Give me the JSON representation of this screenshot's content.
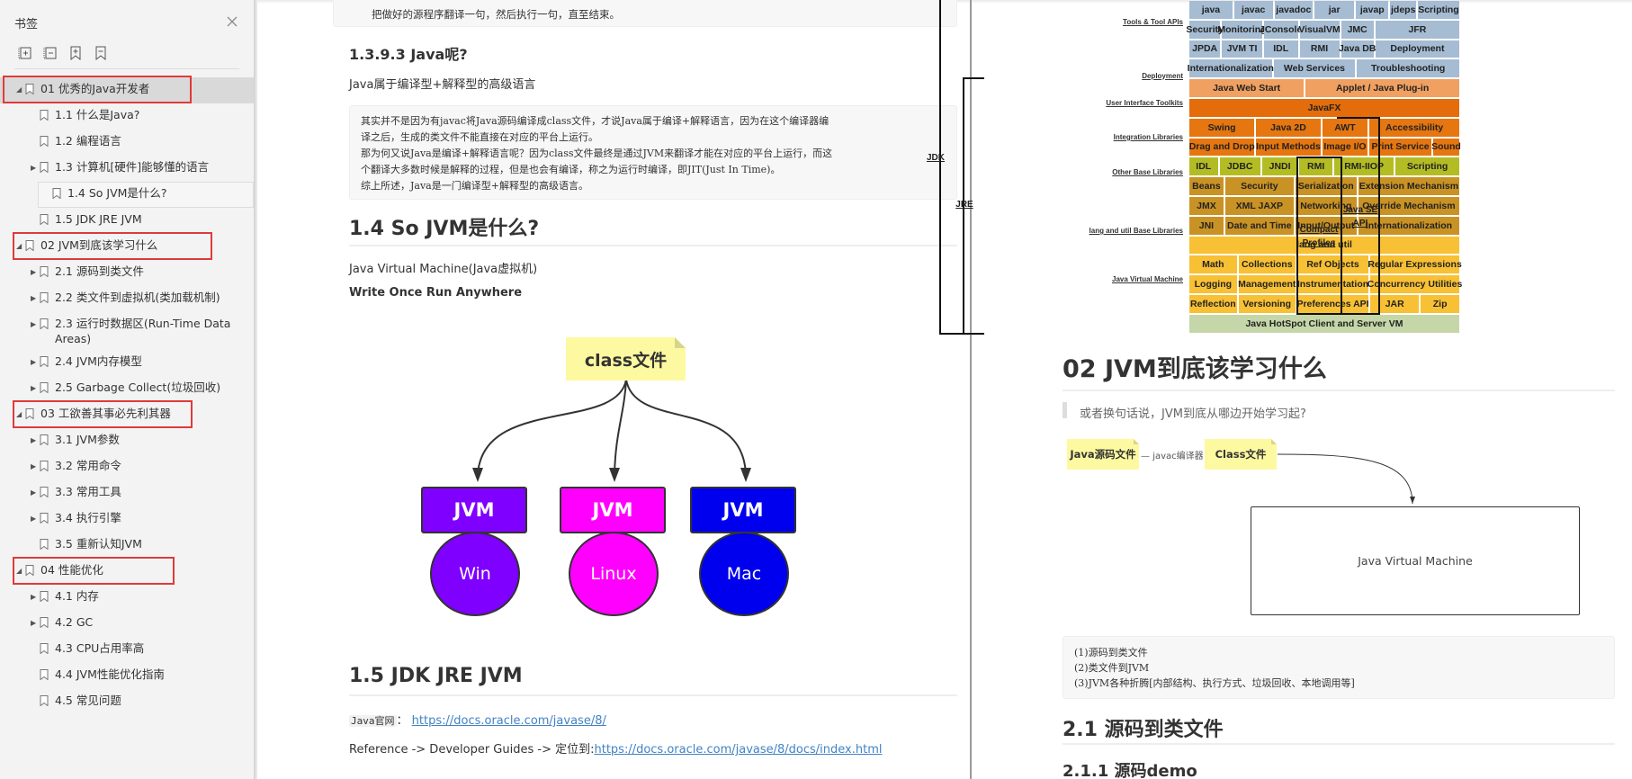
{
  "sidebar": {
    "title": "书签",
    "close_icon": "close-icon",
    "toolbar": [
      {
        "name": "expand-all-icon",
        "title": "expand all"
      },
      {
        "name": "collapse-all-icon",
        "title": "collapse all"
      },
      {
        "name": "add-bookmark-icon",
        "title": "add bookmark"
      },
      {
        "name": "remove-bookmark-icon",
        "title": "remove bookmark"
      }
    ],
    "items": [
      {
        "level": 0,
        "label": "01 优秀的Java开发者",
        "expanded": true,
        "hasChildren": true,
        "highlighted": true,
        "selected": true
      },
      {
        "level": 1,
        "label": "1.1 什么是Java?",
        "hasChildren": false
      },
      {
        "level": 1,
        "label": "1.2 编程语言",
        "hasChildren": false
      },
      {
        "level": 1,
        "label": "1.3 计算机[硬件]能够懂的语言",
        "hasChildren": true
      },
      {
        "level": 1,
        "label": "1.4 So JVM是什么?",
        "hasChildren": false,
        "current": true
      },
      {
        "level": 1,
        "label": "1.5 JDK JRE JVM",
        "hasChildren": false
      },
      {
        "level": 0,
        "label": "02 JVM到底该学习什么",
        "expanded": true,
        "hasChildren": true,
        "highlighted": true
      },
      {
        "level": 1,
        "label": "2.1 源码到类文件",
        "hasChildren": true
      },
      {
        "level": 1,
        "label": "2.2 类文件到虚拟机(类加载机制)",
        "hasChildren": true
      },
      {
        "level": 1,
        "label": "2.3 运行时数据区(Run-Time Data Areas)",
        "hasChildren": true
      },
      {
        "level": 1,
        "label": "2.4 JVM内存模型",
        "hasChildren": true
      },
      {
        "level": 1,
        "label": "2.5 Garbage Collect(垃圾回收)",
        "hasChildren": true
      },
      {
        "level": 0,
        "label": "03 工欲善其事必先利其器",
        "expanded": true,
        "hasChildren": true,
        "highlighted": true
      },
      {
        "level": 1,
        "label": "3.1 JVM参数",
        "hasChildren": true
      },
      {
        "level": 1,
        "label": "3.2 常用命令",
        "hasChildren": true
      },
      {
        "level": 1,
        "label": "3.3 常用工具",
        "hasChildren": true
      },
      {
        "level": 1,
        "label": "3.4 执行引擎",
        "hasChildren": true
      },
      {
        "level": 1,
        "label": "3.5 重新认知JVM",
        "hasChildren": false
      },
      {
        "level": 0,
        "label": "04 性能优化",
        "expanded": true,
        "hasChildren": true,
        "highlighted": true
      },
      {
        "level": 1,
        "label": "4.1 内存",
        "hasChildren": true
      },
      {
        "level": 1,
        "label": "4.2 GC",
        "hasChildren": true
      },
      {
        "level": 1,
        "label": "4.3 CPU占用率高",
        "hasChildren": false
      },
      {
        "level": 1,
        "label": "4.4 JVM性能优化指南",
        "hasChildren": false
      },
      {
        "level": 1,
        "label": "4.5 常见问题",
        "hasChildren": false
      }
    ]
  },
  "page1": {
    "top_code_line": "把做好的源程序翻译一句，然后执行一句，直至结束。",
    "h_1393": "1.3.9.3 Java呢?",
    "p_1393": "Java属于编译型+解释型的高级语言",
    "code_1393": [
      "其实并不是因为有javac将Java源码编译成class文件，才说Java属于编译+解释语言，因为在这个编译器编",
      "译之后，生成的类文件不能直接在对应的平台上运行。",
      "那为何又说Java是编译+解释语言呢？因为class文件最终是通过JVM来翻译才能在对应的平台上运行，而这",
      "个翻译大多数时候是解释的过程，但是也会有编译，称之为运行时编译，即JIT(Just In Time)。",
      "综上所述，Java是一门编译型+解释型的高级语言。"
    ],
    "h_14": "1.4 So JVM是什么?",
    "p_14_a": "Java Virtual Machine(Java虚拟机)",
    "p_14_b": "Write Once Run Anywhere",
    "diagram": {
      "root": "class文件",
      "nodes": [
        {
          "box": "JVM",
          "os": "Win",
          "color": "#7f00ff"
        },
        {
          "box": "JVM",
          "os": "Linux",
          "color": "#ff00ff"
        },
        {
          "box": "JVM",
          "os": "Mac",
          "color": "#0000ee"
        }
      ]
    },
    "h_15": "1.5 JDK JRE JVM",
    "p_15_code": "Java官网",
    "p_15_sep": "：",
    "p_15_link": "https://docs.oracle.com/javase/8/",
    "p_15b_text": "Reference -> Developer Guides -> 定位到:",
    "p_15b_link": "https://docs.oracle.com/javase/8/docs/index.html"
  },
  "jse_diagram": {
    "colors": {
      "tools": "#a5bcd3",
      "deploy": "#f0a060",
      "ui": "#e6760f",
      "integration": "#b4bc24",
      "other": "#c99224",
      "lang": "#f8c034",
      "vm": "#c5d7a8"
    },
    "side_labels": {
      "tools": "Tools & Tool APIs",
      "deploy": "Deployment",
      "ui": "User Interface Toolkits",
      "integration": "Integration Libraries",
      "other": "Other Base Libraries",
      "lang": "lang and util Base Libraries",
      "vm": "Java Virtual Machine"
    },
    "brackets": {
      "jdk": "JDK",
      "jre": "JRE",
      "compact": "Compact Profiles",
      "javase": "Java SE API"
    },
    "rows": [
      {
        "group": "tools",
        "cells": [
          "java",
          "javac",
          "javadoc",
          "jar",
          "javap",
          "jdeps",
          "Scripting"
        ]
      },
      {
        "group": "tools",
        "cells": [
          "Security",
          "Monitoring",
          "JConsole",
          "VisualVM",
          "JMC",
          "JFR"
        ]
      },
      {
        "group": "tools",
        "cells": [
          "JPDA",
          "JVM TI",
          "IDL",
          "RMI",
          "Java DB",
          "Deployment"
        ]
      },
      {
        "group": "tools",
        "cells": [
          "Internationalization",
          "Web Services",
          "Troubleshooting"
        ]
      },
      {
        "group": "deploy",
        "cells": [
          "Java Web Start",
          "Applet / Java Plug-in"
        ]
      },
      {
        "group": "ui",
        "cells": [
          "JavaFX"
        ]
      },
      {
        "group": "ui",
        "cells": [
          "Swing",
          "Java 2D",
          "AWT",
          "Accessibility"
        ]
      },
      {
        "group": "ui",
        "cells": [
          "Drag and Drop",
          "Input Methods",
          "Image I/O",
          "Print Service",
          "Sound"
        ]
      },
      {
        "group": "integration",
        "cells": [
          "IDL",
          "JDBC",
          "JNDI",
          "RMI",
          "RMI-IIOP",
          "Scripting"
        ]
      },
      {
        "group": "other",
        "cells": [
          "Beans",
          "Security",
          "Serialization",
          "Extension Mechanism"
        ]
      },
      {
        "group": "other",
        "cells": [
          "JMX",
          "XML JAXP",
          "Networking",
          "Override Mechanism"
        ]
      },
      {
        "group": "other",
        "cells": [
          "JNI",
          "Date and Time",
          "Input/Output",
          "Internationalization"
        ]
      },
      {
        "group": "lang",
        "cells": [
          "lang and util"
        ]
      },
      {
        "group": "lang",
        "cells": [
          "Math",
          "Collections",
          "Ref Objects",
          "Regular Expressions"
        ]
      },
      {
        "group": "lang",
        "cells": [
          "Logging",
          "Management",
          "Instrumentation",
          "Concurrency Utilities"
        ]
      },
      {
        "group": "lang",
        "cells": [
          "Reflection",
          "Versioning",
          "Preferences API",
          "JAR",
          "Zip"
        ]
      },
      {
        "group": "vm",
        "cells": [
          "Java HotSpot Client and Server VM"
        ]
      }
    ]
  },
  "page2": {
    "h_02": "02 JVM到底该学习什么",
    "quote": "或者换句话说，JVM到底从哪边开始学习起?",
    "flow": {
      "src": "Java源码文件",
      "edge": "javac编译器",
      "dst": "Class文件",
      "jvm": "Java Virtual Machine"
    },
    "code_lines": [
      "(1)源码到类文件",
      "(2)类文件到JVM",
      "(3)JVM各种折腾[内部结构、执行方式、垃圾回收、本地调用等]"
    ],
    "h_21": "2.1 源码到类文件",
    "h_211": "2.1.1 源码demo"
  }
}
